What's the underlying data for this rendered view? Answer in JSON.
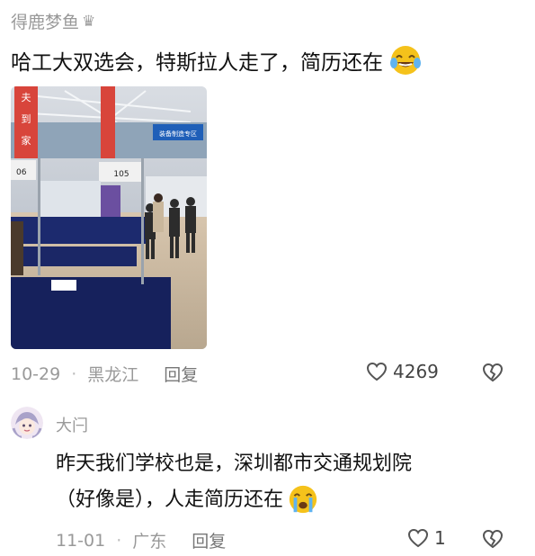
{
  "post": {
    "username": "得鹿梦鱼",
    "text": "哈工大双选会，特斯拉人走了，简历还在",
    "date": "10-29",
    "location": "黑龙江",
    "reply_label": "回复",
    "like_count": "4269",
    "photo_signs": {
      "banner_left": "夫到家",
      "booth_left": "06",
      "booth_center": "105",
      "zone_sign": "装备制造专区"
    }
  },
  "comment": {
    "username": "大闩",
    "text_line1": "昨天我们学校也是，深圳都市交通规划院",
    "text_line2": "（好像是），人走简历还在",
    "date": "11-01",
    "location": "广东",
    "reply_label": "回复",
    "like_count": "1"
  },
  "icons": {
    "crown": "crown-icon",
    "laugh_emoji": "tears-of-joy-emoji",
    "cry_emoji": "crying-emoji",
    "like": "heart-outline-icon",
    "dislike": "broken-heart-icon"
  },
  "colors": {
    "muted_text": "#999999",
    "body_text": "#111111",
    "emoji_yellow": "#f5c21b"
  }
}
